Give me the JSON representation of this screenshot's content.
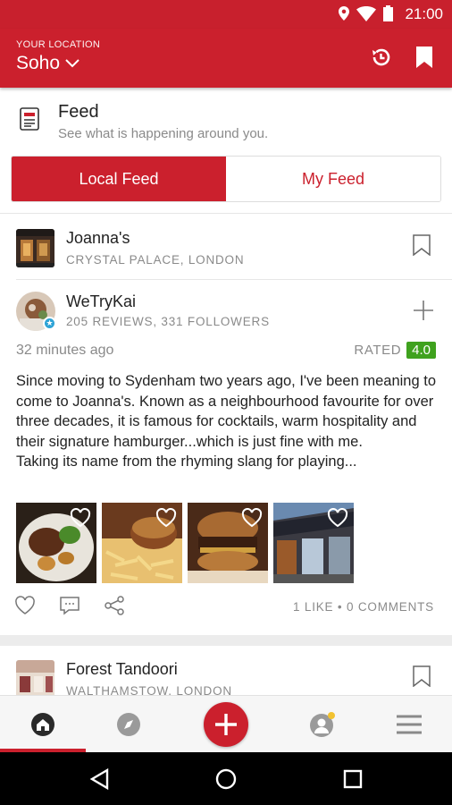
{
  "status_bar": {
    "time": "21:00",
    "icons": [
      "location-icon",
      "wifi-icon",
      "battery-icon"
    ]
  },
  "header": {
    "location_label": "YOUR LOCATION",
    "city": "Soho"
  },
  "feed_header": {
    "title": "Feed",
    "subtitle": "See what is happening around you."
  },
  "tabs": [
    {
      "label": "Local Feed",
      "active": true
    },
    {
      "label": "My Feed",
      "active": false
    }
  ],
  "restaurant": {
    "name": "Joanna's",
    "location": "CRYSTAL PALACE, LONDON"
  },
  "post": {
    "user": "WeTryKai",
    "user_stats": "205 REVIEWS, 331 FOLLOWERS",
    "time_ago": "32 minutes ago",
    "rated_label": "RATED",
    "rating": "4.0",
    "review_line1": "Since moving to Sydenham two years ago, I've been meaning to come to Joanna's. Known as a neighbourhood favourite for over three decades, it is famous for cocktails, warm hospitality and their signature hamburger...which is just fine with me.",
    "review_line2": "Taking its name from the rhyming slang for playing...",
    "photos": [
      "steak-photo",
      "burger-fries-photo",
      "burger-photo",
      "storefront-photo"
    ],
    "engagement": "1 LIKE • 0 COMMENTS"
  },
  "next_restaurant": {
    "name": "Forest Tandoori",
    "location": "WALTHAMSTOW, LONDON"
  },
  "bottom_nav": [
    "home-icon",
    "explore-icon",
    "add-icon",
    "profile-icon",
    "menu-icon"
  ],
  "colors": {
    "brand": "#cb202d",
    "rating": "#3fa21e"
  }
}
